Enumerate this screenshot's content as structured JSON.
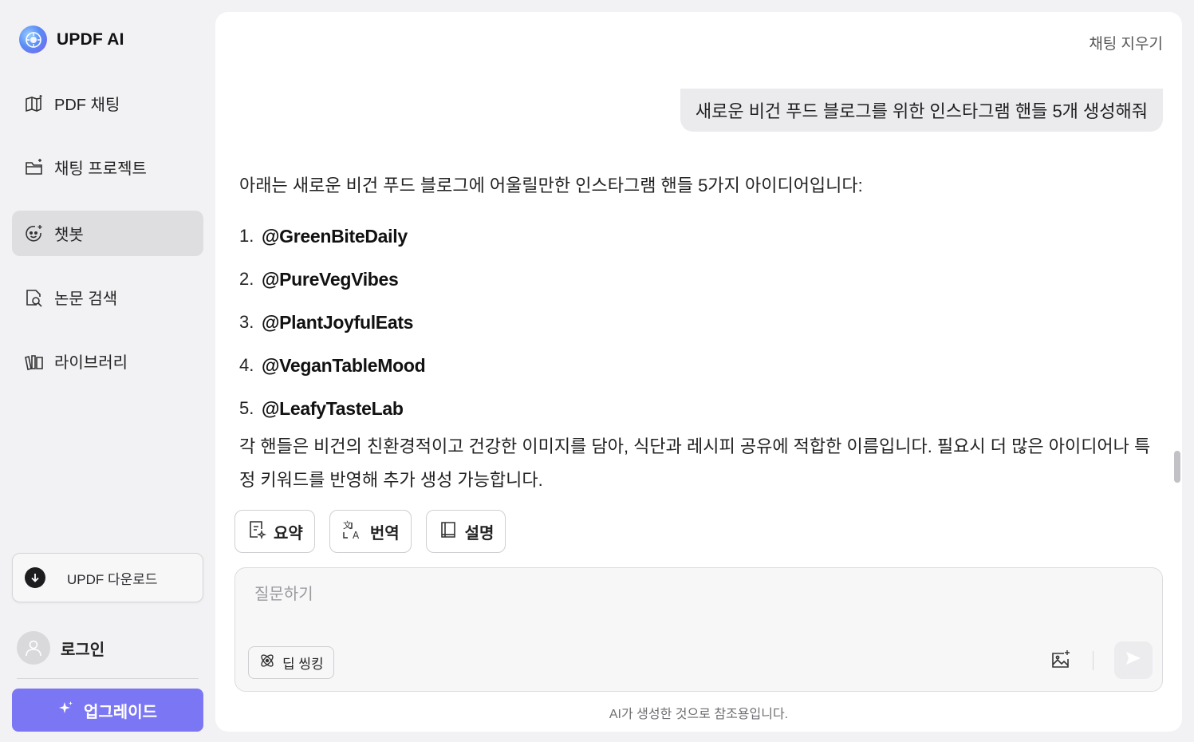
{
  "sidebar": {
    "brand": "UPDF AI",
    "items": [
      {
        "label": "PDF 채팅",
        "icon": "book-sparkle-icon"
      },
      {
        "label": "채팅 프로젝트",
        "icon": "folder-sparkle-icon"
      },
      {
        "label": "챗봇",
        "icon": "bot-face-icon",
        "active": true
      },
      {
        "label": "논문 검색",
        "icon": "document-search-icon"
      },
      {
        "label": "라이브러리",
        "icon": "library-books-icon"
      }
    ],
    "download_label": "UPDF 다운로드",
    "login_label": "로그인",
    "upgrade_label": "업그레이드"
  },
  "main": {
    "clear_chat": "채팅 지우기",
    "user_message": "새로운 비건 푸드 블로그를 위한 인스타그램 핸들 5개 생성해줘",
    "answer": {
      "intro": "아래는 새로운 비건 푸드 블로그에 어울릴만한 인스타그램 핸들 5가지 아이디어입니다:",
      "handles": [
        {
          "num": "1.",
          "name": "@GreenBiteDaily"
        },
        {
          "num": "2.",
          "name": "@PureVegVibes"
        },
        {
          "num": "3.",
          "name": "@PlantJoyfulEats"
        },
        {
          "num": "4.",
          "name": "@VeganTableMood"
        },
        {
          "num": "5.",
          "name": "@LeafyTasteLab"
        }
      ],
      "outro": "각 핸들은 비건의 친환경적이고 건강한 이미지를 담아, 식단과 레시피 공유에 적합한 이름입니다. 필요시 더 많은 아이디어나 특정 키워드를 반영해 추가 생성 가능합니다."
    },
    "actions": {
      "summary": "요약",
      "translate": "번역",
      "explain": "설명"
    },
    "input": {
      "placeholder": "질문하기",
      "deep_think": "딥 씽킹"
    },
    "disclaimer": "AI가 생성한 것으로 참조용입니다."
  },
  "colors": {
    "accent": "#7b77f4",
    "background": "#f2f2f4",
    "active_nav": "#dedee1"
  }
}
